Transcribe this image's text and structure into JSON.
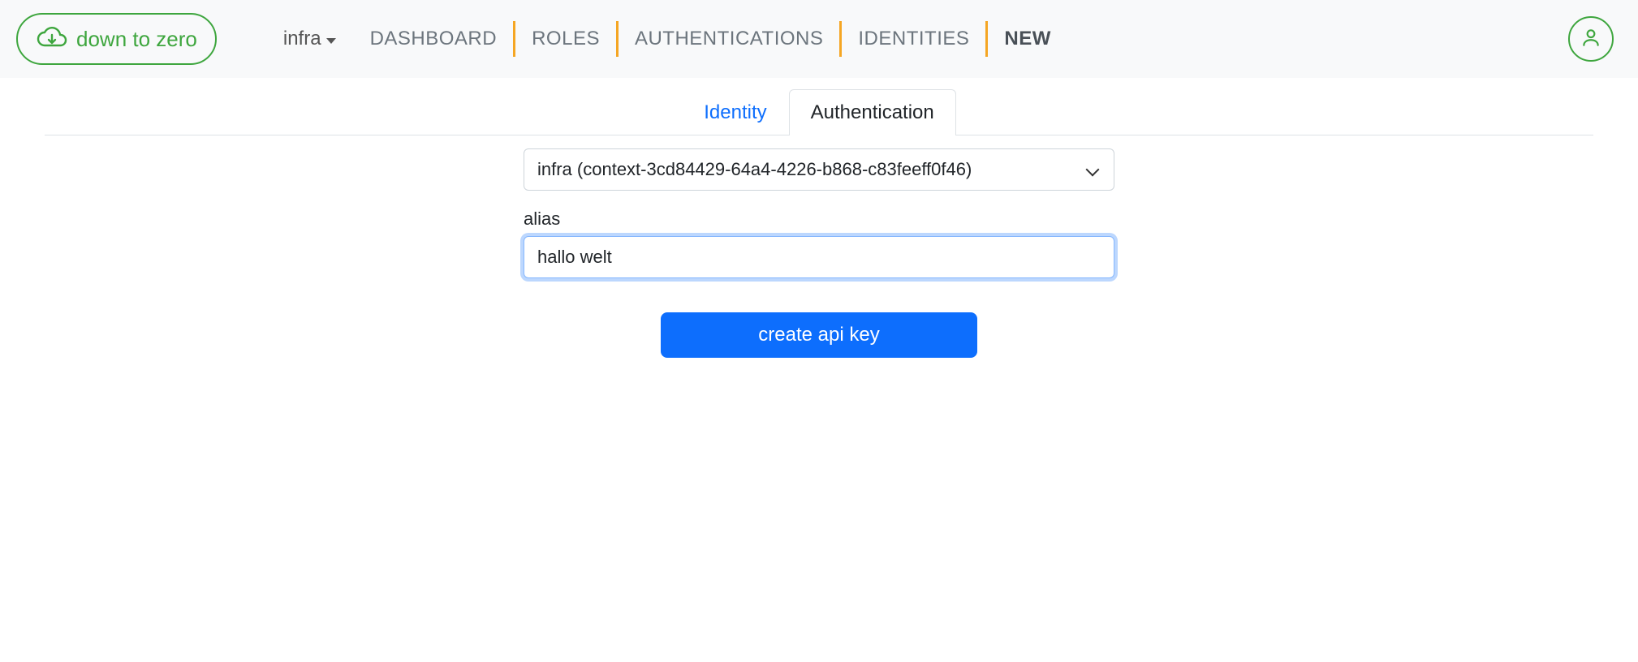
{
  "brand": {
    "text": "down to zero"
  },
  "nav": {
    "context_label": "infra",
    "items": [
      "DASHBOARD",
      "ROLES",
      "AUTHENTICATIONS",
      "IDENTITIES",
      "NEW"
    ],
    "active_index": 4
  },
  "tabs": {
    "identity": "Identity",
    "authentication": "Authentication",
    "active": "authentication"
  },
  "form": {
    "context_select_value": "infra (context-3cd84429-64a4-4226-b868-c83feeff0f46)",
    "alias_label": "alias",
    "alias_value": "hallo welt",
    "submit_label": "create api key"
  }
}
